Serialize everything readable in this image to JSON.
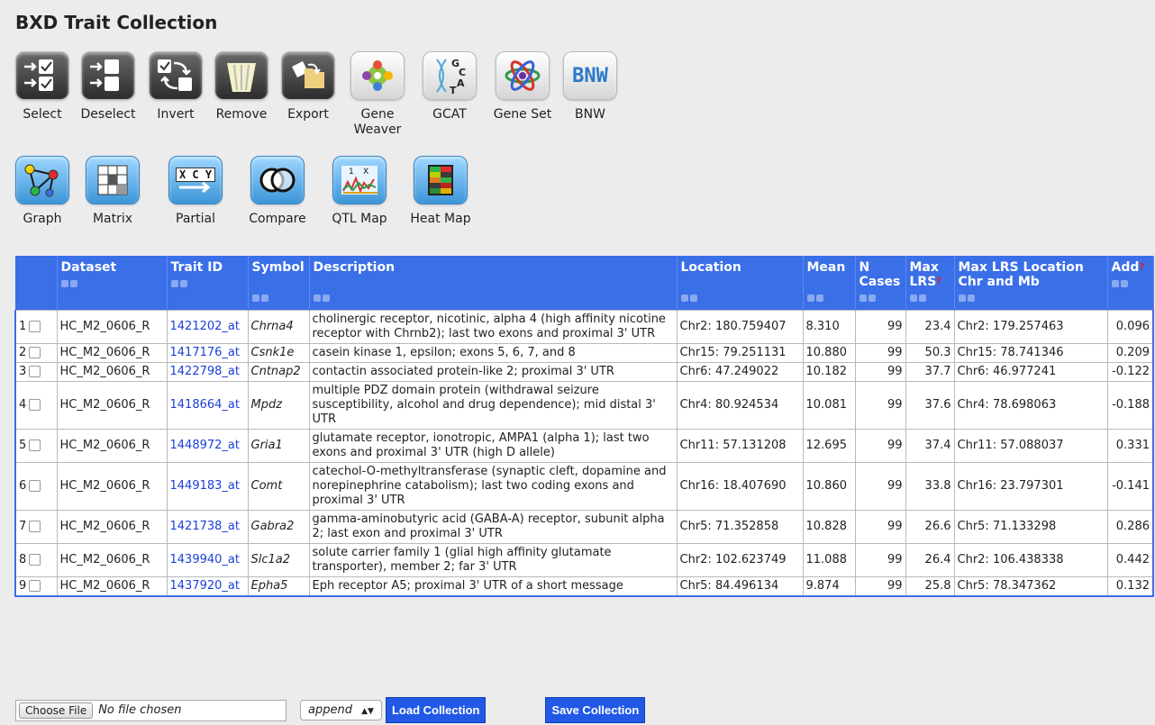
{
  "page_title": "BXD Trait Collection",
  "toolbar_row1": [
    {
      "label": "Select",
      "icon": "select-icon"
    },
    {
      "label": "Deselect",
      "icon": "deselect-icon"
    },
    {
      "label": "Invert",
      "icon": "invert-icon"
    },
    {
      "label": "Remove",
      "icon": "trash-icon"
    },
    {
      "label": "Export",
      "icon": "export-icon"
    },
    {
      "label": "Gene Weaver",
      "icon": "geneweaver-icon"
    },
    {
      "label": "GCAT",
      "icon": "gcat-icon"
    },
    {
      "label": "Gene Set",
      "icon": "geneset-icon"
    },
    {
      "label": "BNW",
      "icon": "bnw-icon",
      "icon_text": "BNW"
    }
  ],
  "toolbar_row2": [
    {
      "label": "Graph",
      "icon": "network-graph-icon"
    },
    {
      "label": "Matrix",
      "icon": "matrix-icon"
    },
    {
      "label": "Partial",
      "icon": "partial-correlation-icon",
      "icon_text": "X C Y"
    },
    {
      "label": "Compare",
      "icon": "venn-icon"
    },
    {
      "label": "QTL Map",
      "icon": "qtl-map-icon"
    },
    {
      "label": "Heat Map",
      "icon": "heatmap-icon"
    }
  ],
  "table": {
    "headers": {
      "dataset": "Dataset",
      "trait_id": "Trait ID",
      "symbol": "Symbol",
      "description": "Description",
      "location": "Location",
      "mean": "Mean",
      "n_cases": "N Cases",
      "max_lrs": "Max LRS",
      "max_lrs_location": "Max LRS Location Chr and Mb",
      "add": "Add"
    },
    "rows": [
      {
        "index": "1",
        "dataset": "HC_M2_0606_R",
        "trait_id": "1421202_at",
        "symbol": "Chrna4",
        "description": "cholinergic receptor, nicotinic, alpha 4 (high affinity nicotine receptor with Chrnb2); last two exons and proximal 3' UTR",
        "location": "Chr2: 180.759407",
        "mean": "8.310",
        "n_cases": "99",
        "max_lrs": "23.4",
        "max_lrs_location": "Chr2: 179.257463",
        "add": "0.096"
      },
      {
        "index": "2",
        "dataset": "HC_M2_0606_R",
        "trait_id": "1417176_at",
        "symbol": "Csnk1e",
        "description": "casein kinase 1, epsilon; exons 5, 6, 7, and 8",
        "location": "Chr15: 79.251131",
        "mean": "10.880",
        "n_cases": "99",
        "max_lrs": "50.3",
        "max_lrs_location": "Chr15: 78.741346",
        "add": "0.209"
      },
      {
        "index": "3",
        "dataset": "HC_M2_0606_R",
        "trait_id": "1422798_at",
        "symbol": "Cntnap2",
        "description": "contactin associated protein-like 2; proximal 3' UTR",
        "location": "Chr6: 47.249022",
        "mean": "10.182",
        "n_cases": "99",
        "max_lrs": "37.7",
        "max_lrs_location": "Chr6: 46.977241",
        "add": "-0.122"
      },
      {
        "index": "4",
        "dataset": "HC_M2_0606_R",
        "trait_id": "1418664_at",
        "symbol": "Mpdz",
        "description": "multiple PDZ domain protein (withdrawal seizure susceptibility, alcohol and drug dependence); mid distal 3' UTR",
        "location": "Chr4: 80.924534",
        "mean": "10.081",
        "n_cases": "99",
        "max_lrs": "37.6",
        "max_lrs_location": "Chr4: 78.698063",
        "add": "-0.188"
      },
      {
        "index": "5",
        "dataset": "HC_M2_0606_R",
        "trait_id": "1448972_at",
        "symbol": "Gria1",
        "description": "glutamate receptor, ionotropic, AMPA1 (alpha 1); last two exons and proximal 3' UTR (high D allele)",
        "location": "Chr11: 57.131208",
        "mean": "12.695",
        "n_cases": "99",
        "max_lrs": "37.4",
        "max_lrs_location": "Chr11: 57.088037",
        "add": "0.331"
      },
      {
        "index": "6",
        "dataset": "HC_M2_0606_R",
        "trait_id": "1449183_at",
        "symbol": "Comt",
        "description": "catechol-O-methyltransferase (synaptic cleft, dopamine and norepinephrine catabolism); last two coding exons and proximal 3' UTR",
        "location": "Chr16: 18.407690",
        "mean": "10.860",
        "n_cases": "99",
        "max_lrs": "33.8",
        "max_lrs_location": "Chr16: 23.797301",
        "add": "-0.141"
      },
      {
        "index": "7",
        "dataset": "HC_M2_0606_R",
        "trait_id": "1421738_at",
        "symbol": "Gabra2",
        "description": "gamma-aminobutyric acid (GABA-A) receptor, subunit alpha 2; last exon and proximal 3' UTR",
        "location": "Chr5: 71.352858",
        "mean": "10.828",
        "n_cases": "99",
        "max_lrs": "26.6",
        "max_lrs_location": "Chr5: 71.133298",
        "add": "0.286"
      },
      {
        "index": "8",
        "dataset": "HC_M2_0606_R",
        "trait_id": "1439940_at",
        "symbol": "Slc1a2",
        "description": "solute carrier family 1 (glial high affinity glutamate transporter), member 2; far 3' UTR",
        "location": "Chr2: 102.623749",
        "mean": "11.088",
        "n_cases": "99",
        "max_lrs": "26.4",
        "max_lrs_location": "Chr2: 106.438338",
        "add": "0.442"
      },
      {
        "index": "9",
        "dataset": "HC_M2_0606_R",
        "trait_id": "1437920_at",
        "symbol": "Epha5",
        "description": "Eph receptor A5; proximal 3' UTR of a short message",
        "location": "Chr5: 84.496134",
        "mean": "9.874",
        "n_cases": "99",
        "max_lrs": "25.8",
        "max_lrs_location": "Chr5: 78.347362",
        "add": "0.132"
      }
    ]
  },
  "bottom": {
    "choose_file_label": "Choose File",
    "file_status": "No file chosen",
    "mode_select": "append",
    "load_button": "Load Collection",
    "save_button": "Save Collection"
  }
}
